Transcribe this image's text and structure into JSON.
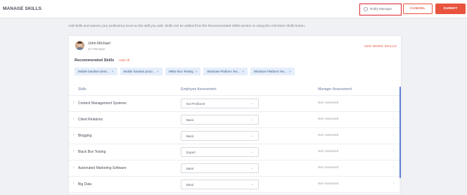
{
  "header": {
    "title": "MANAGE SKILLS",
    "notify_label": "Notify Manager",
    "cancel_label": "CANCEL",
    "submit_label": "SUBMIT"
  },
  "help_text": "Add skills and assess your proficiency level on the skill you add. Skills can be added from the Recommended Skills section or using the Add More Skills button.",
  "user": {
    "name": "John Michael",
    "role": "QA Manager"
  },
  "add_more_label": "ADD MORE SKILLS",
  "recommended": {
    "title": "Recommended Skills",
    "add_all_label": "Add All",
    "chips": [
      {
        "label": "Mobile handset devic...",
        "remove": "×"
      },
      {
        "label": "Mobile handset proto...",
        "remove": "×"
      },
      {
        "label": "White Box Testing",
        "remove": "×"
      },
      {
        "label": "Windows Platform Tes...",
        "remove": "×"
      },
      {
        "label": "Windows Platform Tes...",
        "remove": "×"
      }
    ]
  },
  "table": {
    "headers": {
      "skills": "Skills",
      "employee": "Employee Assessment",
      "manager": "Manager Assessment"
    },
    "rows": [
      {
        "skill": "Content Management Systems",
        "employee": "Not Proficient",
        "manager": "Not Assessed"
      },
      {
        "skill": "Client Relations",
        "employee": "Basic",
        "manager": "Not Assessed"
      },
      {
        "skill": "Blogging",
        "employee": "Basic",
        "manager": "Not Assessed"
      },
      {
        "skill": "Black Box Testing",
        "employee": "Expert",
        "manager": "Not Assessed"
      },
      {
        "skill": "Automated Marketing Software",
        "employee": "Basic",
        "manager": "Not Assessed"
      },
      {
        "skill": "Big Data",
        "employee": "Basic",
        "manager": "Not Assessed"
      }
    ]
  },
  "icons": {
    "notify": "clock-icon",
    "expand": "chevron-right-icon",
    "dropdown": "chevron-down-icon"
  },
  "colors": {
    "accent": "#e8543d",
    "highlight_border": "#d9232e",
    "chip_bg": "#e4eefb",
    "scrollbar": "#5b7fd6"
  }
}
